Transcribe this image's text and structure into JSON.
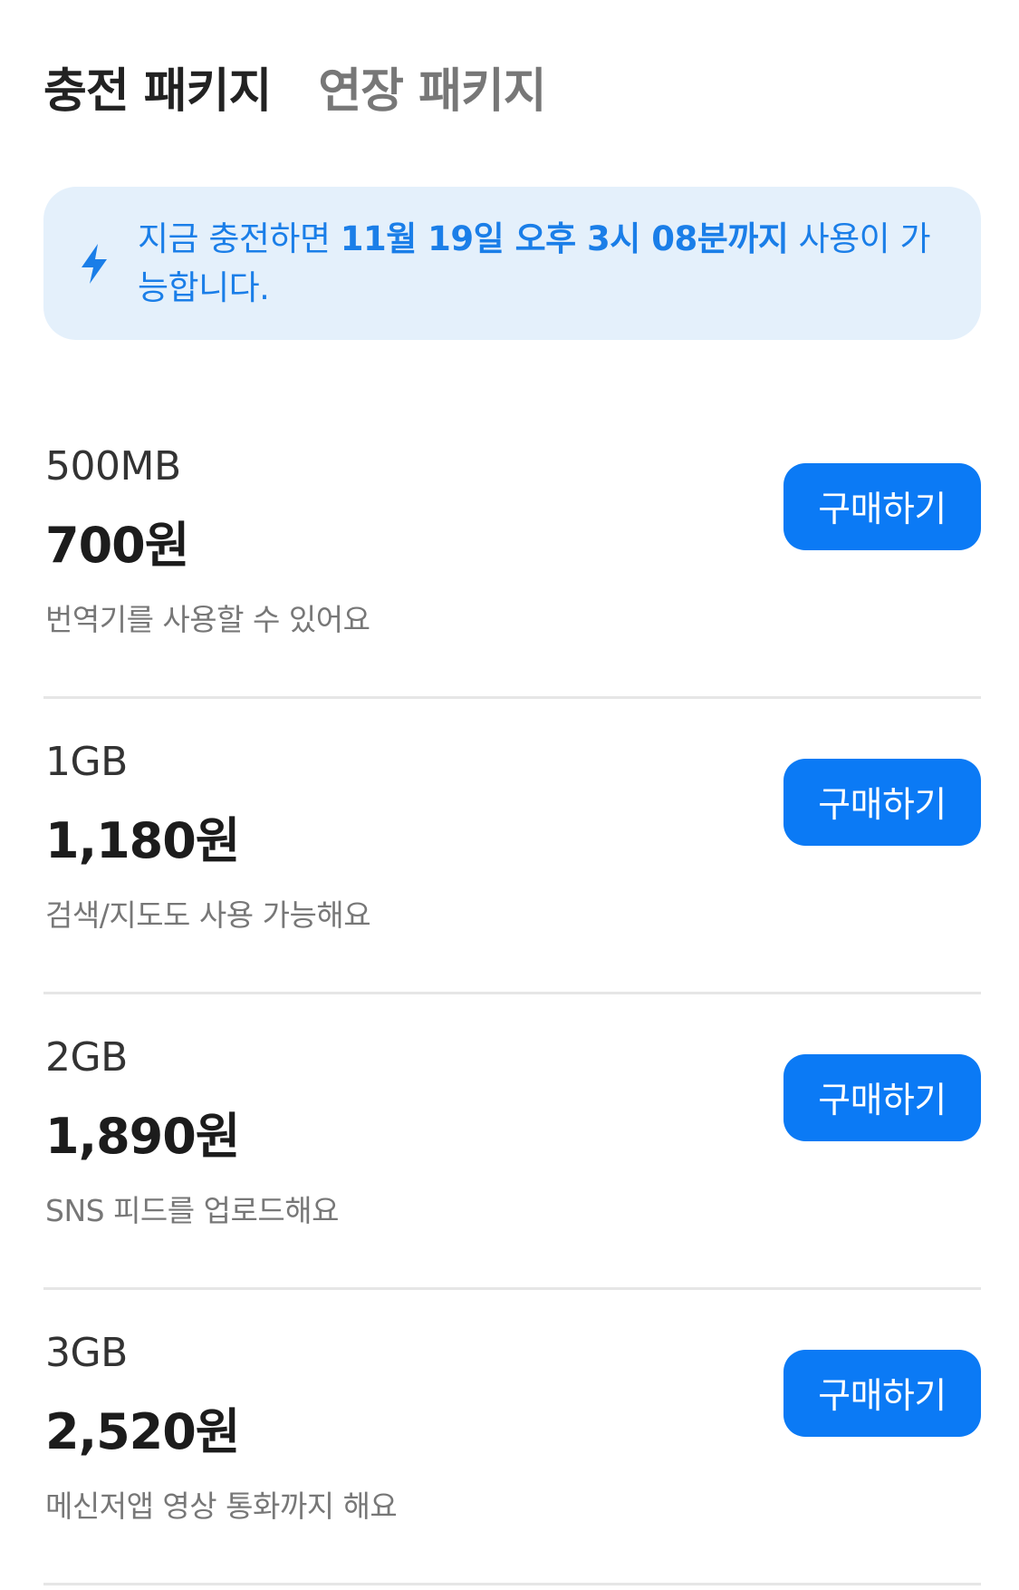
{
  "tabs": [
    {
      "label": "충전 패키지",
      "active": true
    },
    {
      "label": "연장 패키지",
      "active": false
    }
  ],
  "notice": {
    "icon": "lightning-bolt-icon",
    "prefix": "지금 충전하면 ",
    "highlight": "11월 19일 오후 3시 08분까지",
    "suffix": " 사용이 가능합니다."
  },
  "packages": [
    {
      "size": "500MB",
      "price": "700원",
      "desc": "번역기를 사용할 수 있어요",
      "button": "구매하기"
    },
    {
      "size": "1GB",
      "price": "1,180원",
      "desc": "검색/지도도 사용 가능해요",
      "button": "구매하기"
    },
    {
      "size": "2GB",
      "price": "1,890원",
      "desc": "SNS 피드를 업로드해요",
      "button": "구매하기"
    },
    {
      "size": "3GB",
      "price": "2,520원",
      "desc": "메신저앱 영상 통화까지 해요",
      "button": "구매하기"
    }
  ],
  "colors": {
    "accent": "#0b7af5",
    "notice_bg": "#e4f0fb",
    "notice_text": "#1a7ee8"
  }
}
